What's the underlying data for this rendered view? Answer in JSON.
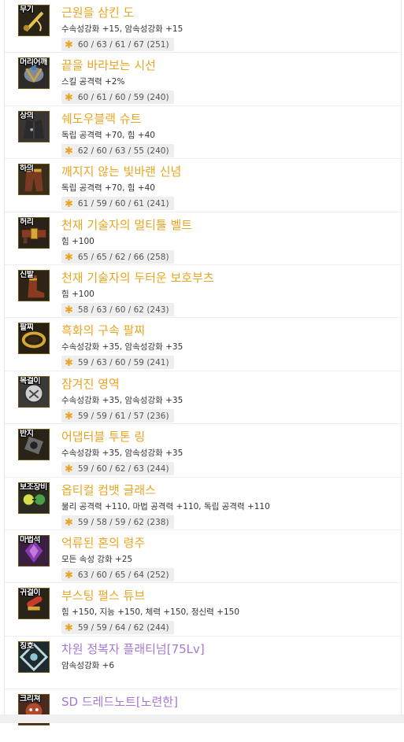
{
  "items": [
    {
      "slot": "무기",
      "name": "근원을 삼킨 도",
      "stats": "수속성강화 +15, 암속성강화 +15",
      "grow": "60 / 63 / 61 / 67 (251)",
      "rarity": "gold",
      "icon": "sword-icon"
    },
    {
      "slot": "머리어깨",
      "name": "끝을 바라보는 시선",
      "stats": "스킬 공격력 +2%",
      "grow": "60 / 61 / 60 / 59 (240)",
      "rarity": "gold",
      "icon": "shoulder-armor-icon"
    },
    {
      "slot": "상의",
      "name": "쉐도우블랙 슈트",
      "stats": "독립 공격력 +70, 힘 +40",
      "grow": "62 / 60 / 63 / 55 (240)",
      "rarity": "gold",
      "icon": "jacket-icon"
    },
    {
      "slot": "하의",
      "name": "깨지지 않는 빛바랜 신념",
      "stats": "독립 공격력 +70, 힘 +40",
      "grow": "61 / 59 / 60 / 61 (241)",
      "rarity": "gold",
      "icon": "pants-icon"
    },
    {
      "slot": "허리",
      "name": "천재 기술자의 멀티툴 벨트",
      "stats": "힘 +100",
      "grow": "65 / 65 / 62 / 66 (258)",
      "rarity": "gold",
      "icon": "belt-icon"
    },
    {
      "slot": "신발",
      "name": "천재 기술자의 두터운 보호부츠",
      "stats": "힘 +100",
      "grow": "58 / 63 / 60 / 62 (243)",
      "rarity": "gold",
      "icon": "boots-icon"
    },
    {
      "slot": "팔찌",
      "name": "흑화의 구속 팔찌",
      "stats": "수속성강화 +35, 암속성강화 +35",
      "grow": "59 / 63 / 60 / 59 (241)",
      "rarity": "gold",
      "icon": "bracelet-icon"
    },
    {
      "slot": "목걸이",
      "name": "잠겨진 영역",
      "stats": "수속성강화 +35, 암속성강화 +35",
      "grow": "59 / 59 / 61 / 57 (236)",
      "rarity": "gold",
      "icon": "necklace-icon"
    },
    {
      "slot": "반지",
      "name": "어댑터블 투톤 링",
      "stats": "수속성강화 +35, 암속성강화 +35",
      "grow": "59 / 60 / 62 / 63 (244)",
      "rarity": "gold",
      "icon": "ring-icon"
    },
    {
      "slot": "보조장비",
      "name": "옵티컬 컴뱃 글래스",
      "stats": "물리 공격력 +110, 마법 공격력 +110, 독립 공격력 +110",
      "grow": "59 / 58 / 59 / 62 (238)",
      "rarity": "gold",
      "icon": "glasses-icon"
    },
    {
      "slot": "마법석",
      "name": "억류된 혼의 령주",
      "stats": "모든 속성 강화 +25",
      "grow": "63 / 60 / 65 / 64 (252)",
      "rarity": "gold",
      "icon": "magic-stone-icon"
    },
    {
      "slot": "귀걸이",
      "name": "부스팅 펄스 튜브",
      "stats": "힘 +150, 지능 +150, 체력 +150, 정신력 +150",
      "grow": "59 / 59 / 64 / 62 (244)",
      "rarity": "gold",
      "icon": "earring-icon"
    },
    {
      "slot": "칭호",
      "name": "차원 정복자 플래티넘[75Lv]",
      "stats": "암속성강화 +6",
      "grow": "",
      "rarity": "purple",
      "icon": "title-emblem-icon"
    },
    {
      "slot": "크리쳐",
      "name": "SD 드레드노트[노련한]",
      "stats": "",
      "grow": "",
      "rarity": "purple",
      "icon": "creature-icon"
    }
  ],
  "colors": {
    "gold": "#e8a523",
    "purple": "#a678d6"
  }
}
